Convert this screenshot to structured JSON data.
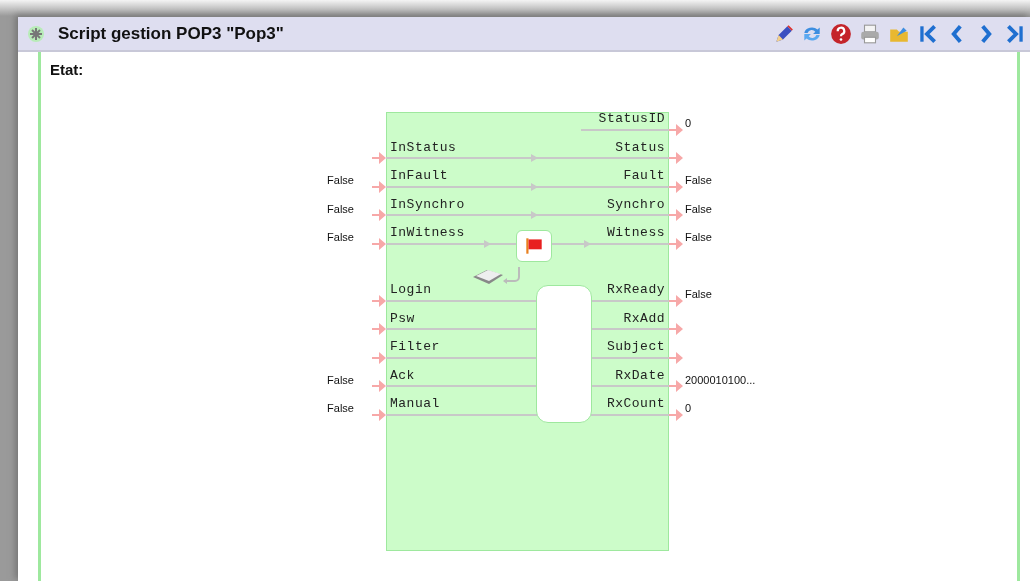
{
  "window": {
    "title": "Script gestion POP3 \"Pop3\""
  },
  "toolbar": [
    {
      "kind": "edit"
    },
    {
      "kind": "refresh"
    },
    {
      "kind": "help"
    },
    {
      "kind": "print"
    },
    {
      "kind": "folder"
    },
    {
      "kind": "first"
    },
    {
      "kind": "prev"
    },
    {
      "kind": "next"
    },
    {
      "kind": "last"
    }
  ],
  "section_label": "Etat:",
  "groups": [
    {
      "kind": "status",
      "rows": [
        {
          "output": "StatusID",
          "output_value": "0"
        },
        {
          "input": "InStatus",
          "output": "Status"
        },
        {
          "input": "InFault",
          "input_value": "False",
          "output": "Fault",
          "output_value": "False"
        },
        {
          "input": "InSynchro",
          "input_value": "False",
          "output": "Synchro",
          "output_value": "False"
        },
        {
          "input": "InWitness",
          "input_value": "False",
          "output": "Witness",
          "output_value": "False"
        }
      ]
    },
    {
      "kind": "mail",
      "rows": [
        {
          "input": "Login",
          "output": "RxReady",
          "output_value": "False"
        },
        {
          "input": "Psw",
          "output": "RxAdd"
        },
        {
          "input": "Filter",
          "output": "Subject"
        },
        {
          "input": "Ack",
          "input_value": "False",
          "output": "RxDate",
          "output_value": "2000010100..."
        },
        {
          "input": "Manual",
          "input_value": "False",
          "output": "RxCount",
          "output_value": "0"
        }
      ]
    }
  ]
}
